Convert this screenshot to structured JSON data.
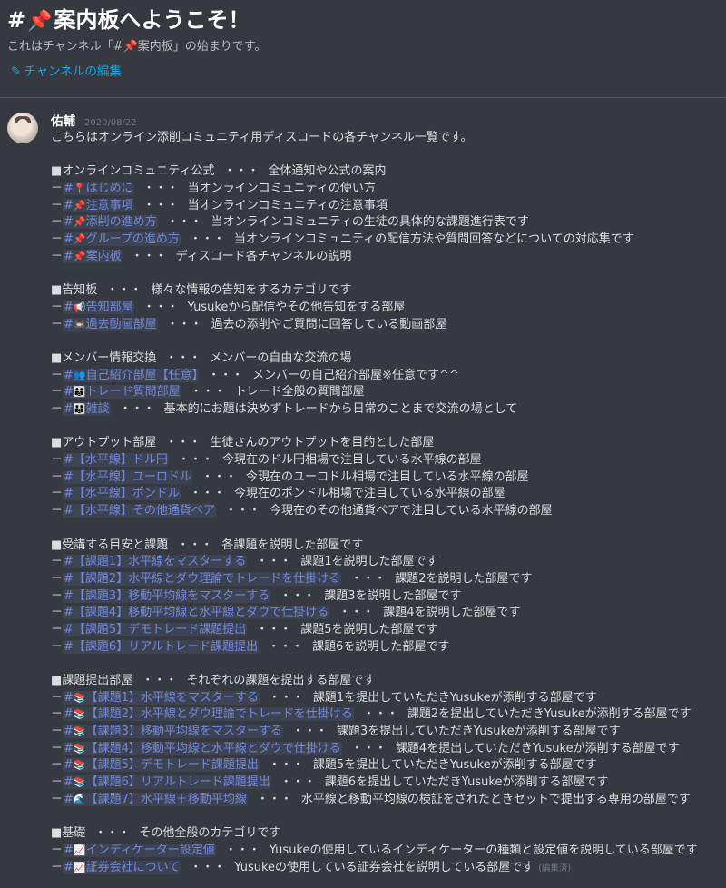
{
  "header": {
    "hash": "#",
    "pin_icon": "📌",
    "title": "案内板へようこそ！",
    "subtitle": "これはチャンネル「#📌案内板」の始まりです。",
    "edit_label": "チャンネルの編集",
    "edit_icon": "pencil-icon"
  },
  "message": {
    "username": "佑輔",
    "timestamp": "2020/08/22",
    "intro": "こちらはオンライン添削コミュニティ用ディスコードの各チャンネル一覧です。",
    "dots": "・・・",
    "edited": "(編集済)",
    "sections": [
      {
        "heading": "■オンラインコミュニティ公式",
        "heading_desc": "全体通知や公式の案内",
        "items": [
          {
            "emoji": "📍",
            "name": "はじめに",
            "desc": "当オンラインコミュニティの使い方"
          },
          {
            "emoji": "📌",
            "name": "注意事項",
            "desc": "当オンラインコミュニティの注意事項"
          },
          {
            "emoji": "📌",
            "name": "添削の進め方",
            "desc": "当オンラインコミュニティの生徒の具体的な課題進行表です"
          },
          {
            "emoji": "📌",
            "name": "グループの進め方",
            "desc": "当オンラインコミュニティの配信方法や質問回答などについての対応集です"
          },
          {
            "emoji": "📌",
            "name": "案内板",
            "desc": "ディスコード各チャンネルの説明"
          }
        ]
      },
      {
        "heading": "■告知板",
        "heading_desc": "様々な情報の告知をするカテゴリです",
        "items": [
          {
            "emoji": "📢",
            "name": "告知部屋",
            "desc": "Yusukeから配信やその他告知をする部屋"
          },
          {
            "emoji": "📼",
            "name": "過去動画部屋",
            "desc": "過去の添削やご質問に回答している動画部屋"
          }
        ]
      },
      {
        "heading": "■メンバー情報交換",
        "heading_desc": "メンバーの自由な交流の場",
        "items": [
          {
            "emoji": "👥",
            "name": "自己紹介部屋【任意】",
            "desc": "メンバーの自己紹介部屋※任意です^^"
          },
          {
            "emoji": "👪",
            "name": "トレード質問部屋",
            "desc": "トレード全般の質問部屋"
          },
          {
            "emoji": "👪",
            "name": "雑談",
            "desc": "基本的にお題は決めずトレードから日常のことまで交流の場として"
          }
        ]
      },
      {
        "heading": "■アウトプット部屋",
        "heading_desc": "生徒さんのアウトプットを目的とした部屋",
        "items": [
          {
            "emoji": "",
            "name": "【水平線】ドル円",
            "desc": "今現在のドル円相場で注目している水平線の部屋"
          },
          {
            "emoji": "",
            "name": "【水平線】ユーロドル",
            "desc": "今現在のユーロドル相場で注目している水平線の部屋"
          },
          {
            "emoji": "",
            "name": "【水平線】ポンドル",
            "desc": "今現在のポンドル相場で注目している水平線の部屋"
          },
          {
            "emoji": "",
            "name": "【水平線】その他通貨ペア",
            "desc": "今現在のその他通貨ペアで注目している水平線の部屋"
          }
        ]
      },
      {
        "heading": "■受講する目安と課題",
        "heading_desc": "各課題を説明した部屋です",
        "items": [
          {
            "emoji": "",
            "name": "【課題1】水平線をマスターする",
            "desc": "課題1を説明した部屋です"
          },
          {
            "emoji": "",
            "name": "【課題2】水平線とダウ理論でトレードを仕掛ける",
            "desc": "課題2を説明した部屋です"
          },
          {
            "emoji": "",
            "name": "【課題3】移動平均線をマスターする",
            "desc": "課題3を説明した部屋です"
          },
          {
            "emoji": "",
            "name": "【課題4】移動平均線と水平線とダウで仕掛ける",
            "desc": "課題4を説明した部屋です"
          },
          {
            "emoji": "",
            "name": "【課題5】デモトレード課題提出",
            "desc": "課題5を説明した部屋です"
          },
          {
            "emoji": "",
            "name": "【課題6】リアルトレード課題提出",
            "desc": "課題6を説明した部屋です"
          }
        ]
      },
      {
        "heading": "■課題提出部屋",
        "heading_desc": "それぞれの課題を提出する部屋です",
        "items": [
          {
            "emoji": "📚",
            "name": "【課題1】水平線をマスターする",
            "desc": "課題1を提出していただきYusukeが添削する部屋です"
          },
          {
            "emoji": "📚",
            "name": "【課題2】水平線とダウ理論でトレードを仕掛ける",
            "desc": "課題2を提出していただきYusukeが添削する部屋です"
          },
          {
            "emoji": "📚",
            "name": "【課題3】移動平均線をマスターする",
            "desc": "課題3を提出していただきYusukeが添削する部屋です"
          },
          {
            "emoji": "📚",
            "name": "【課題4】移動平均線と水平線とダウで仕掛ける",
            "desc": "課題4を提出していただきYusukeが添削する部屋です"
          },
          {
            "emoji": "📚",
            "name": "【課題5】デモトレード課題提出",
            "desc": "課題5を提出していただきYusukeが添削する部屋です"
          },
          {
            "emoji": "📚",
            "name": "【課題6】リアルトレード課題提出",
            "desc": "課題6を提出していただきYusukeが添削する部屋です"
          },
          {
            "emoji": "🌊",
            "name": "【課題7】水平線＋移動平均線",
            "desc": "水平線と移動平均線の検証をされたときセットで提出する専用の部屋です"
          }
        ]
      },
      {
        "heading": "■基礎",
        "heading_desc": "その他全般のカテゴリです",
        "items": [
          {
            "emoji": "📈",
            "name": "インディケーター設定値",
            "desc": "Yusukeの使用しているインディケーターの種類と設定値を説明している部屋です"
          },
          {
            "emoji": "📈",
            "name": "証券会社について",
            "desc": "Yusukeの使用している証券会社を説明している部屋です"
          }
        ]
      }
    ]
  }
}
